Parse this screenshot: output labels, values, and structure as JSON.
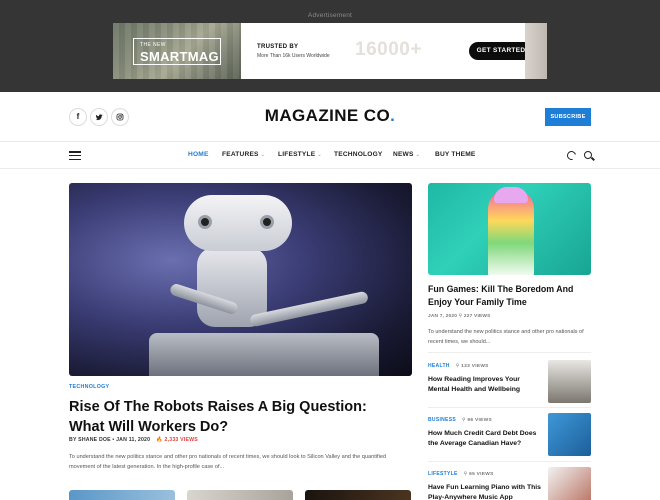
{
  "ad": {
    "label": "Advertisement",
    "logo_small": "THE NEW",
    "logo_big": "SMARTMAG",
    "trusted": "TRUSTED BY",
    "trusted_sub": "More Than 16k Users Worldwide",
    "count": "16000+",
    "cta": "GET STARTED"
  },
  "header": {
    "social": [
      "f",
      "t",
      "ig"
    ],
    "brand_name": "MAGAZINE CO",
    "brand_dot": ".",
    "subscribe": "SUBSCRIBE"
  },
  "nav": {
    "items": [
      {
        "label": "HOME",
        "active": true
      },
      {
        "label": "FEATURES",
        "dropdown": true
      },
      {
        "label": "LIFESTYLE",
        "dropdown": true
      },
      {
        "label": "TECHNOLOGY"
      },
      {
        "label": "NEWS",
        "dropdown": true
      },
      {
        "label": "BUY THEME"
      }
    ],
    "caret": "⌄",
    "accent": "#1e7dd6"
  },
  "featured": {
    "category": "TECHNOLOGY",
    "title": "Rise Of The Robots Raises A Big Question: What Will Workers Do?",
    "meta_author": "BY SHANE DOE • JAN 11, 2020",
    "meta_views": "🔥 2,333 VIEWS",
    "excerpt": "To understand the new politics stance and other pro nationals of recent times, we should look to Silicon Valley and the quantified movement of the latest generation. In the high-profile case of..."
  },
  "sidebar": {
    "top": {
      "title": "Fun Games: Kill The Boredom And Enjoy Your Family Time",
      "meta": "JAN 7, 2020     ⚲ 227 VIEWS",
      "excerpt": "To understand the new politics stance and other pro nationals of recent times, we should..."
    },
    "items": [
      {
        "category": "HEALTH",
        "views": "⚲ 133 VIEWS",
        "title": "How Reading Improves Your Mental Health and Wellbeing"
      },
      {
        "category": "BUSINESS",
        "views": "⚲ 96 VIEWS",
        "title": "How Much Credit Card Debt Does the Average Canadian Have?"
      },
      {
        "category": "LIFESTYLE",
        "views": "⚲ 65 VIEWS",
        "title": "Have Fun Learning Piano with This Play-Anywhere Music App"
      }
    ]
  }
}
